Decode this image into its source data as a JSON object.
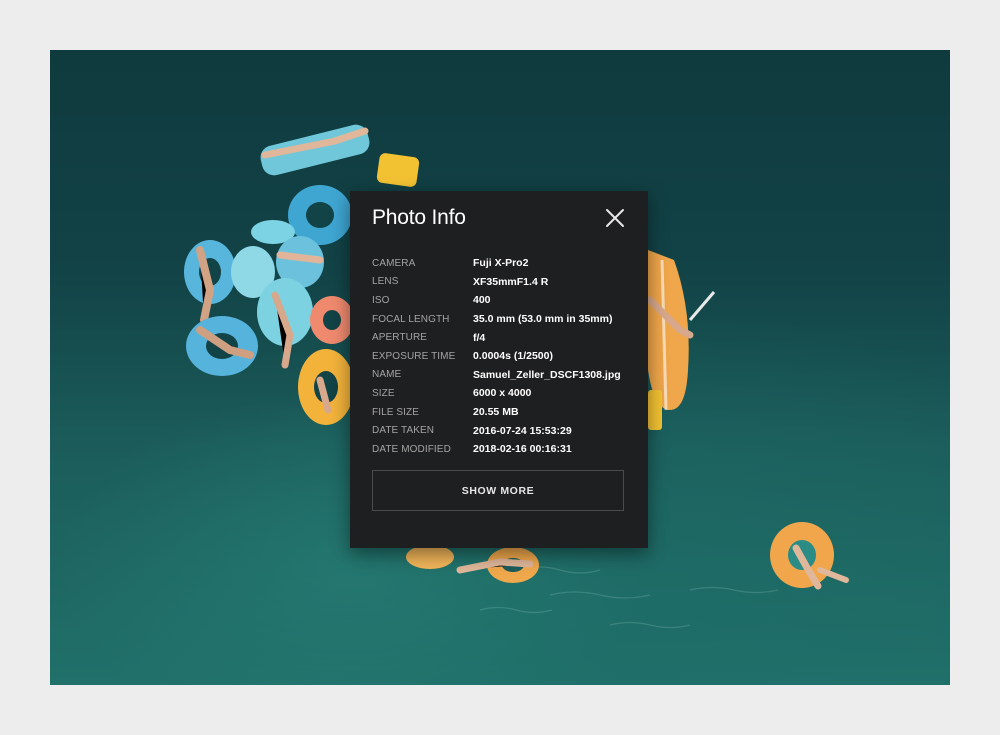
{
  "panel": {
    "title": "Photo Info",
    "close_icon": "close-icon",
    "rows": [
      {
        "label": "CAMERA",
        "value": "Fuji X-Pro2"
      },
      {
        "label": "LENS",
        "value": "XF35mmF1.4 R"
      },
      {
        "label": "ISO",
        "value": "400"
      },
      {
        "label": "FOCAL LENGTH",
        "value": "35.0 mm (53.0 mm in 35mm)"
      },
      {
        "label": "APERTURE",
        "value": "f/4"
      },
      {
        "label": "EXPOSURE TIME",
        "value": "0.0004s (1/2500)"
      },
      {
        "label": "NAME",
        "value": "Samuel_Zeller_DSCF1308.jpg"
      },
      {
        "label": "SIZE",
        "value": "6000 x 4000"
      },
      {
        "label": "FILE SIZE",
        "value": "20.55 MB"
      },
      {
        "label": "DATE TAKEN",
        "value": "2016-07-24 15:53:29"
      },
      {
        "label": "DATE MODIFIED",
        "value": "2018-02-16 00:16:31"
      }
    ],
    "show_more_label": "SHOW MORE"
  },
  "colors": {
    "page_background": "#ededed",
    "panel_background": "#1e1f21",
    "label_text": "#a3a3a3",
    "value_text": "#ffffff",
    "water_dark": "#0f3a3e",
    "water_light": "#21706a"
  }
}
